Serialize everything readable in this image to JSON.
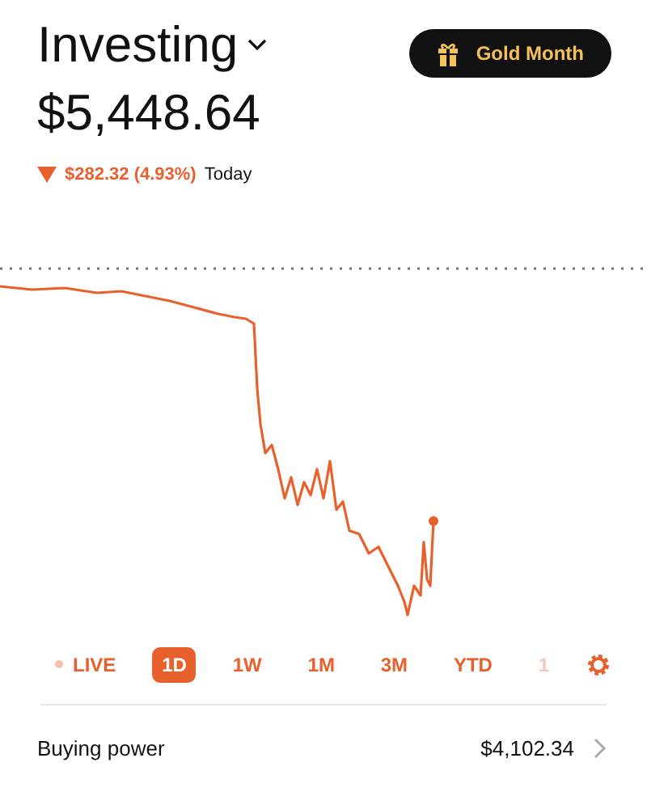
{
  "header": {
    "title": "Investing",
    "button": "Gold Month"
  },
  "portfolio": {
    "value": "$5,448.64",
    "change": "$282.32 (4.93%)",
    "down": true,
    "period": "Today"
  },
  "ranges": [
    {
      "label": "LIVE",
      "kind": "live",
      "selected": false
    },
    {
      "label": "1D",
      "kind": "range",
      "selected": true
    },
    {
      "label": "1W",
      "kind": "range",
      "selected": false
    },
    {
      "label": "1M",
      "kind": "range",
      "selected": false
    },
    {
      "label": "3M",
      "kind": "range",
      "selected": false
    },
    {
      "label": "YTD",
      "kind": "range",
      "selected": false
    },
    {
      "label": "1",
      "kind": "faded",
      "selected": false
    }
  ],
  "buying_power": {
    "label": "Buying power",
    "value": "$4,102.34"
  }
}
